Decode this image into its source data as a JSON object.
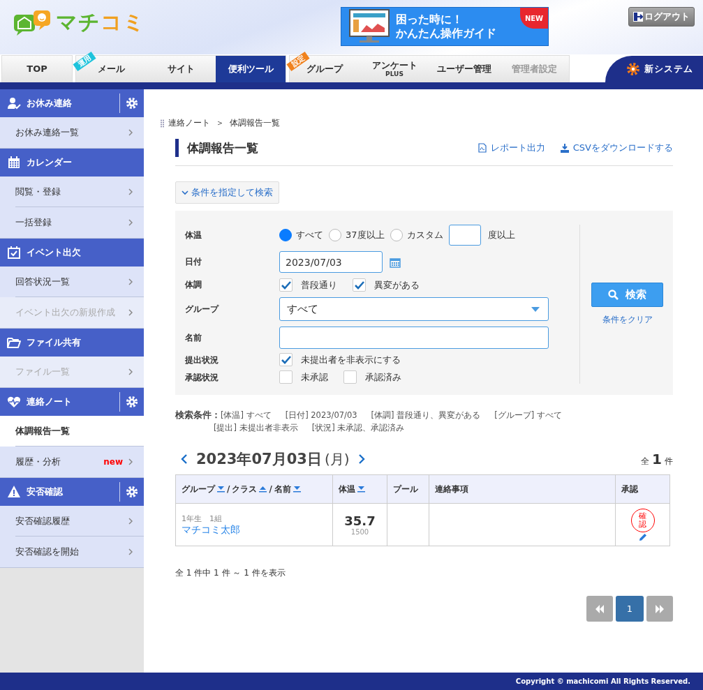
{
  "header": {
    "logo_text": "マチコミ",
    "banner": {
      "line1": "困った時に！",
      "line2": "かんたん操作ガイド",
      "badge": "NEW"
    },
    "logout": "ログアウト"
  },
  "tabs": [
    {
      "label": "TOP",
      "selected": false,
      "disabled": false
    },
    {
      "label": "メール",
      "selected": false,
      "disabled": false,
      "tag": {
        "text": "運用",
        "color": "#1ec3dc"
      }
    },
    {
      "label": "サイト",
      "selected": false,
      "disabled": false
    },
    {
      "label": "便利ツール",
      "selected": true,
      "disabled": false
    },
    {
      "label": "グループ",
      "selected": false,
      "disabled": false,
      "tag": {
        "text": "設定",
        "color": "#f0821e"
      }
    },
    {
      "label": "アンケート",
      "sub": "PLUS",
      "selected": false,
      "disabled": false
    },
    {
      "label": "ユーザー管理",
      "selected": false,
      "disabled": false
    },
    {
      "label": "管理者設定",
      "selected": false,
      "disabled": true
    }
  ],
  "new_system": "新システム",
  "sidebar": {
    "sections": [
      {
        "title": "お休み連絡",
        "has_settings": true,
        "items": [
          {
            "label": "お休み連絡一覧",
            "selected": false,
            "disabled": false
          }
        ]
      },
      {
        "title": "カレンダー",
        "has_settings": false,
        "items": [
          {
            "label": "閲覧・登録",
            "selected": false,
            "disabled": false
          },
          {
            "label": "一括登録",
            "selected": false,
            "disabled": false
          }
        ]
      },
      {
        "title": "イベント出欠",
        "has_settings": false,
        "items": [
          {
            "label": "回答状況一覧",
            "selected": false,
            "disabled": false
          },
          {
            "label": "イベント出欠の新規作成",
            "selected": false,
            "disabled": true
          }
        ]
      },
      {
        "title": "ファイル共有",
        "has_settings": false,
        "items": [
          {
            "label": "ファイル一覧",
            "selected": false,
            "disabled": true
          }
        ]
      },
      {
        "title": "連絡ノート",
        "has_settings": true,
        "items": [
          {
            "label": "体調報告一覧",
            "selected": true,
            "disabled": false
          },
          {
            "label": "履歴・分析",
            "selected": false,
            "disabled": false,
            "badge": "new"
          }
        ]
      },
      {
        "title": "安否確認",
        "has_settings": true,
        "items": [
          {
            "label": "安否確認履歴",
            "selected": false,
            "disabled": false
          },
          {
            "label": "安否確認を開始",
            "selected": false,
            "disabled": false
          }
        ]
      }
    ]
  },
  "breadcrumb": {
    "items": [
      "連絡ノート",
      "体調報告一覧"
    ],
    "separator": "＞"
  },
  "page_title": "体調報告一覧",
  "actions": [
    "レポート出力",
    "CSVをダウンロードする"
  ],
  "search_toggle": {
    "label": "条件を指定して検索",
    "expanded": true
  },
  "form": {
    "temperature": {
      "label": "体温",
      "options": [
        {
          "label": "すべて",
          "selected": true
        },
        {
          "label": "37度以上",
          "selected": false
        },
        {
          "label": "カスタム",
          "selected": false
        }
      ],
      "suffix": "度以上"
    },
    "date": {
      "label": "日付",
      "value": "2023/07/03"
    },
    "condition": {
      "label": "体調",
      "options": [
        {
          "label": "普段通り",
          "checked": true
        },
        {
          "label": "異変がある",
          "checked": true
        }
      ]
    },
    "group": {
      "label": "グループ",
      "value": "すべて"
    },
    "name": {
      "label": "名前"
    },
    "submission": {
      "label": "提出状況",
      "options": [
        {
          "label": "未提出者を非表示にする",
          "checked": true
        }
      ]
    },
    "approval": {
      "label": "承認状況",
      "options": [
        {
          "label": "未承認",
          "checked": false
        },
        {
          "label": "承認済み",
          "checked": false
        }
      ]
    },
    "search_button": "検索",
    "clear_link": "条件をクリア"
  },
  "summary": {
    "label": "検索条件：",
    "lines": [
      [
        "[体温] すべて",
        "[日付] 2023/07/03",
        "[体調] 普段通り、異変がある",
        "[グループ] すべて"
      ],
      [
        "[提出] 未提出者非表示",
        "[状況] 未承認、承認済み"
      ]
    ]
  },
  "date_nav": {
    "date": "2023年07月03日",
    "weekday": "(月)"
  },
  "count": {
    "prefix": "全",
    "value": "1",
    "suffix": "件"
  },
  "table": {
    "separator": "/",
    "columns": [
      {
        "parts": [
          {
            "label": "グループ",
            "sort_ascending": false
          },
          {
            "label": "クラス",
            "sort_ascending": true
          },
          {
            "label": "名前",
            "sort_ascending": false
          }
        ]
      },
      {
        "parts": [
          {
            "label": "体温",
            "sort_ascending": false
          }
        ]
      },
      {
        "parts": [
          {
            "label": "プール"
          }
        ]
      },
      {
        "parts": [
          {
            "label": "連絡事項"
          }
        ]
      },
      {
        "parts": [
          {
            "label": "承認"
          }
        ]
      }
    ],
    "rows": [
      {
        "group": "1年生　1組",
        "name": "マチコミ太郎",
        "temperature": "35.7",
        "time": "1500",
        "approved": true,
        "stamp": "確認"
      }
    ]
  },
  "result_summary": "全 1 件中 1 件 ～ 1 件を表示",
  "pagination": {
    "pages": [
      {
        "label": "1",
        "selected": true
      }
    ]
  },
  "footer": "Copyright © machicomi All Rights Reserved."
}
